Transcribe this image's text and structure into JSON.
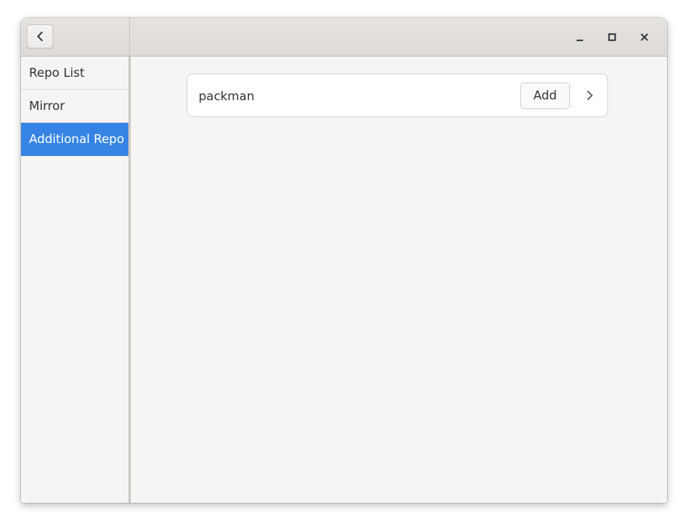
{
  "titlebar": {
    "back_icon": "chevron-left-icon",
    "controls": {
      "minimize_icon": "minimize-icon",
      "maximize_icon": "maximize-icon",
      "close_icon": "close-icon"
    }
  },
  "sidebar": {
    "items": [
      {
        "label": "Repo List",
        "selected": false
      },
      {
        "label": "Mirror",
        "selected": false
      },
      {
        "label": "Additional Repo",
        "selected": true
      }
    ]
  },
  "content": {
    "repos": [
      {
        "name": "packman",
        "action_label": "Add",
        "chevron_icon": "chevron-right-icon"
      }
    ]
  },
  "colors": {
    "accent": "#3584e4",
    "window_bg": "#f6f5f4",
    "titlebar_bg": "#e1dedb",
    "text": "#2e3436"
  }
}
